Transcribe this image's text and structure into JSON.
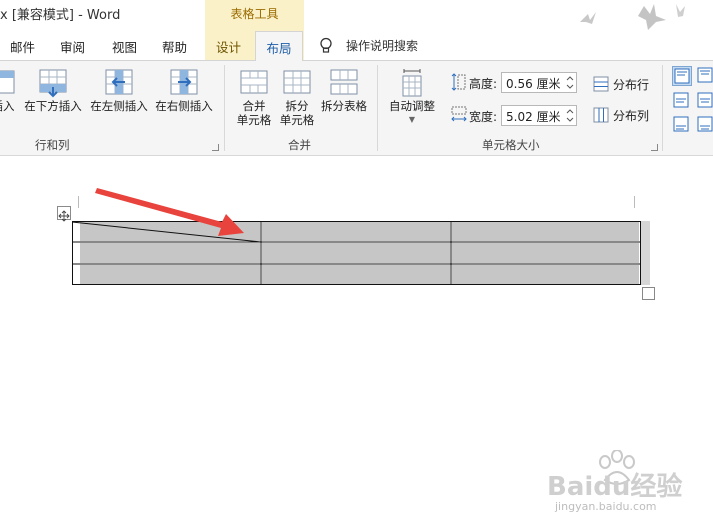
{
  "window": {
    "title": "x [兼容模式]  -  Word",
    "contextual_group": "表格工具"
  },
  "tabs": {
    "mail": "邮件",
    "review": "审阅",
    "view": "视图",
    "help": "帮助",
    "design": "设计",
    "layout": "布局",
    "tell_me": "操作说明搜索"
  },
  "ribbon": {
    "rows_cols": {
      "insert_above_partial": "插入",
      "insert_below": "在下方插入",
      "insert_left": "在左侧插入",
      "insert_right": "在右侧插入",
      "group_label": "行和列"
    },
    "merge": {
      "merge_cells_line1": "合并",
      "merge_cells_line2": "单元格",
      "split_cells_line1": "拆分",
      "split_cells_line2": "单元格",
      "split_table": "拆分表格",
      "group_label": "合并"
    },
    "cell_size": {
      "autofit": "自动调整",
      "height_label": "高度:",
      "height_value": "0.56 厘米",
      "width_label": "宽度:",
      "width_value": "5.02 厘米",
      "distribute_rows": "分布行",
      "distribute_cols": "分布列",
      "group_label": "单元格大小"
    }
  },
  "watermark": {
    "brand": "Baidu经验",
    "url": "jingyan.baidu.com"
  },
  "colors": {
    "accent": "#1f5fa8",
    "contextual_bg": "#fbf1c9",
    "selection_gray": "#c6c6c6",
    "arrow_red": "#e8433c"
  }
}
